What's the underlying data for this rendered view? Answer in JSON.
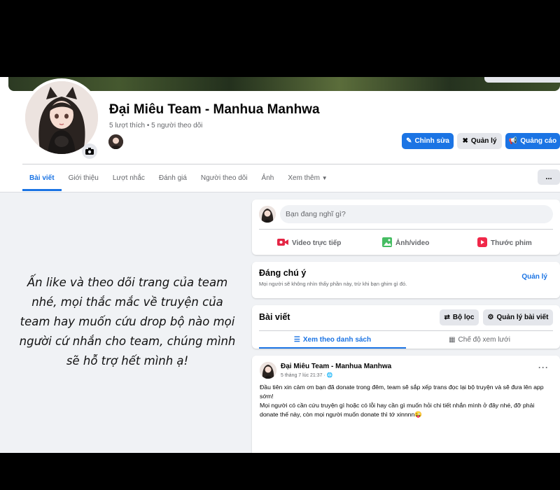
{
  "header": {
    "page_name": "Đại Miêu Team - Manhua Manhwa",
    "stats": "5 lượt thích • 5 người theo dõi",
    "buttons": {
      "edit": "Chỉnh sửa",
      "manage": "Quản lý",
      "promote": "Quảng cáo"
    }
  },
  "tabs": [
    {
      "label": "Bài viết",
      "active": true
    },
    {
      "label": "Giới thiệu"
    },
    {
      "label": "Lượt nhắc"
    },
    {
      "label": "Đánh giá"
    },
    {
      "label": "Người theo dõi"
    },
    {
      "label": "Ảnh"
    },
    {
      "label": "Xem thêm"
    }
  ],
  "more_button": "...",
  "caption": {
    "lines": [
      "Ấn like và theo dõi trang của team",
      "nhé, mọi thắc mắc về truyện của",
      "team hay muốn cứu drop bộ nào mọi",
      "người cứ nhắn cho team, chúng mình",
      "sẽ hỗ trợ hết mình ạ!"
    ]
  },
  "composer": {
    "placeholder": "Bạn đang nghĩ gì?",
    "actions": {
      "live": "Video trực tiếp",
      "photo": "Ảnh/video",
      "reel": "Thước phim"
    }
  },
  "notice": {
    "title": "Đáng chú ý",
    "subtitle": "Mọi người sẽ không nhìn thấy phần này, trừ khi bạn ghim gì đó.",
    "manage": "Quản lý"
  },
  "posts_section": {
    "title": "Bài viết",
    "filter": "Bộ lọc",
    "manage_posts": "Quản lý bài viết",
    "view_list": "Xem theo danh sách",
    "view_grid": "Chế độ xem lưới"
  },
  "post": {
    "author": "Đại Miêu Team - Manhua Manhwa",
    "time": "5 tháng 7 lúc 21:37 · 🌐",
    "more": "···",
    "paragraphs": [
      "Đầu tiên xin cảm ơn bạn đã donate trong đêm, team sẽ sắp xếp trans đọc lại bộ truyện và sẽ đưa lên app sớm!",
      "Mọi người có cần cứu truyện gì hoặc có lỗi hay cần gì muốn hỏi chi tiết nhắn mình ở đây nhé, đỡ phải donate thế này, còn mọi người muốn donate thì tớ xinnnn😜"
    ]
  },
  "colors": {
    "accent": "#1b74e4",
    "background": "#f0f2f5",
    "live": "#e42645",
    "photo": "#45bd62",
    "reel": "#f02849"
  }
}
